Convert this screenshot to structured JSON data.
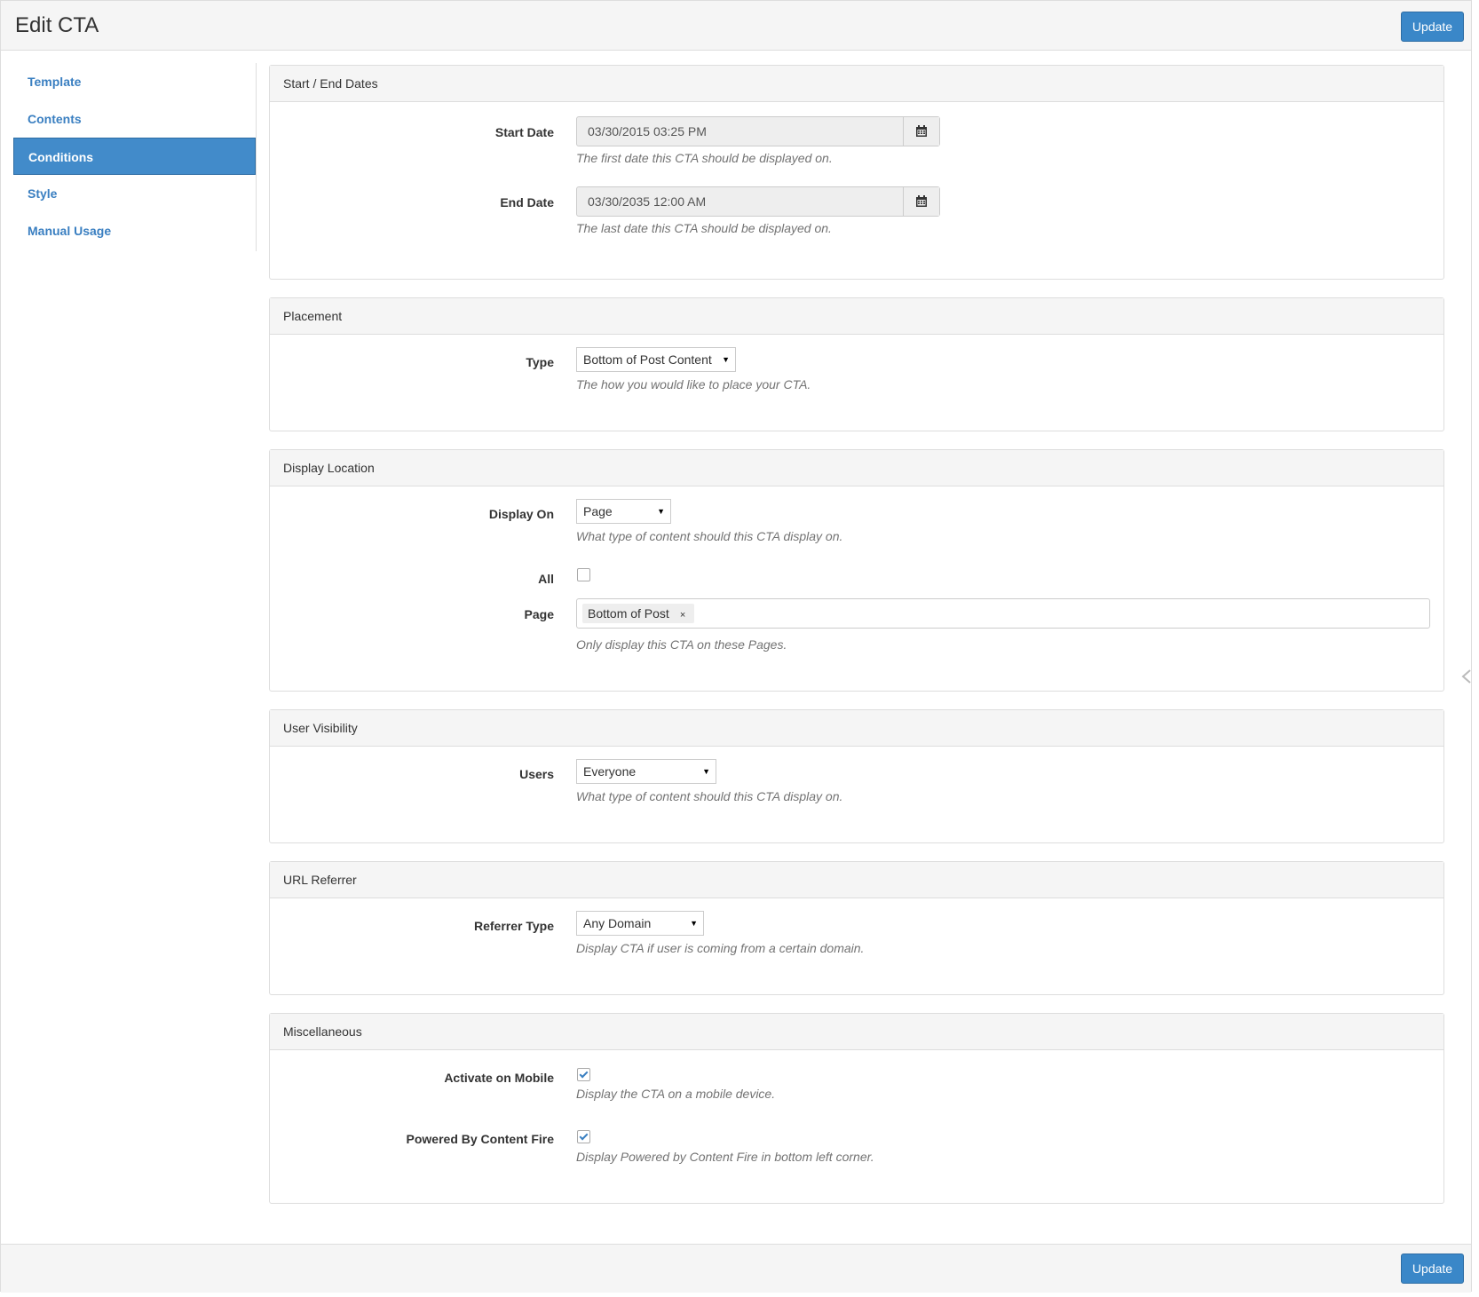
{
  "header": {
    "title": "Edit CTA",
    "update_label": "Update"
  },
  "footer": {
    "update_label": "Update"
  },
  "sidebar": {
    "items": [
      {
        "label": "Template",
        "active": false
      },
      {
        "label": "Contents",
        "active": false
      },
      {
        "label": "Conditions",
        "active": true
      },
      {
        "label": "Style",
        "active": false
      },
      {
        "label": "Manual Usage",
        "active": false
      }
    ]
  },
  "panels": {
    "dates": {
      "heading": "Start / End Dates",
      "start_label": "Start Date",
      "start_value": "03/30/2015 03:25 PM",
      "start_help": "The first date this CTA should be displayed on.",
      "end_label": "End Date",
      "end_value": "03/30/2035 12:00 AM",
      "end_help": "The last date this CTA should be displayed on."
    },
    "placement": {
      "heading": "Placement",
      "type_label": "Type",
      "type_value": "Bottom of Post Content",
      "type_help": "The how you would like to place your CTA."
    },
    "display": {
      "heading": "Display Location",
      "display_on_label": "Display On",
      "display_on_value": "Page",
      "display_on_help": "What type of content should this CTA display on.",
      "all_label": "All",
      "all_checked": false,
      "page_label": "Page",
      "page_tag": "Bottom of Post",
      "page_tag_remove": "×",
      "page_help": "Only display this CTA on these Pages."
    },
    "visibility": {
      "heading": "User Visibility",
      "users_label": "Users",
      "users_value": "Everyone",
      "users_help": "What type of content should this CTA display on."
    },
    "referrer": {
      "heading": "URL Referrer",
      "referrer_label": "Referrer Type",
      "referrer_value": "Any Domain",
      "referrer_help": "Display CTA if user is coming from a certain domain."
    },
    "misc": {
      "heading": "Miscellaneous",
      "mobile_label": "Activate on Mobile",
      "mobile_checked": true,
      "mobile_help": "Display the CTA on a mobile device.",
      "powered_label": "Powered By Content Fire",
      "powered_checked": true,
      "powered_help": "Display Powered by Content Fire in bottom left corner."
    }
  },
  "icons": {
    "calendar": "calendar-icon",
    "dropdown": "caret-down-icon",
    "check": "check-icon"
  },
  "colors": {
    "primary": "#428bca",
    "link": "#3a7fc1",
    "panel_heading_bg": "#f5f5f5",
    "help_text": "#737373"
  }
}
